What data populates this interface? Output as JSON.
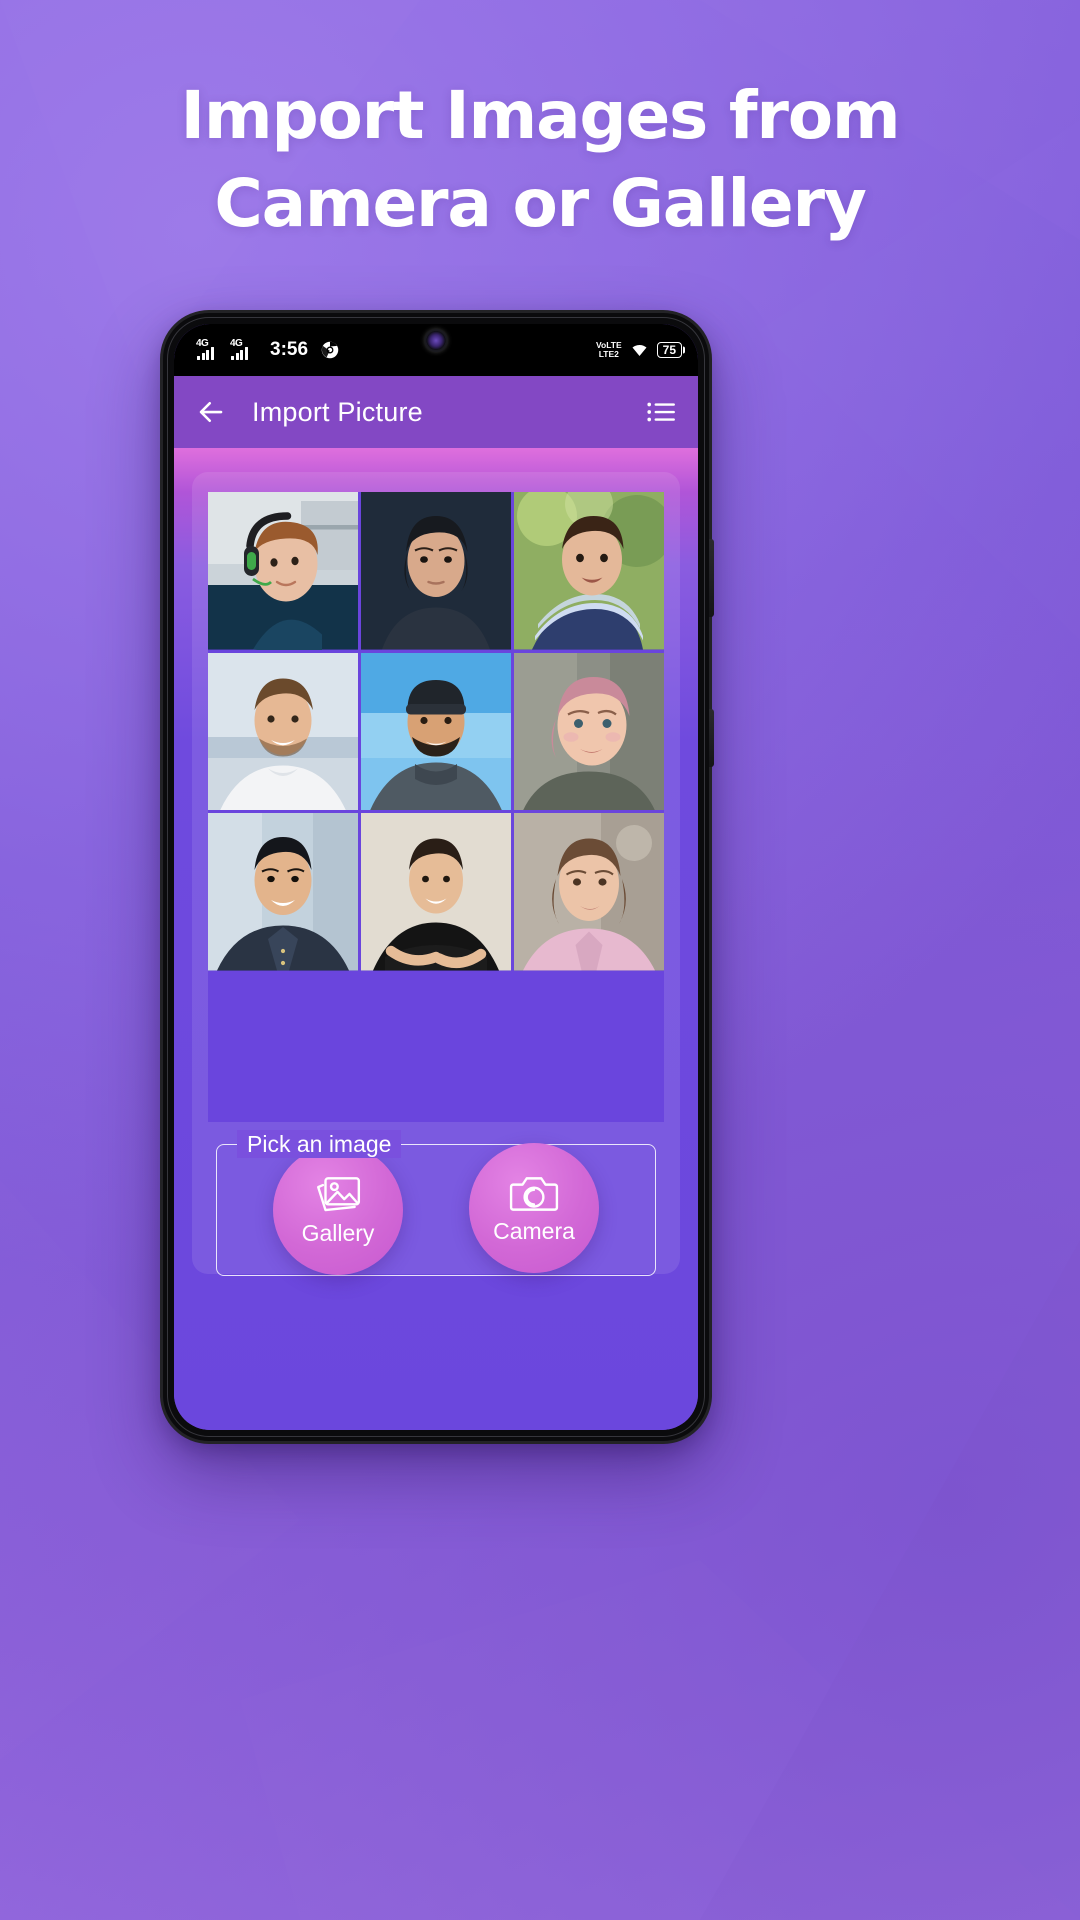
{
  "promo": {
    "headline_line1": "Import Images from",
    "headline_line2": "Camera or Gallery",
    "bg_color": "#8461dd"
  },
  "phone": {
    "statusbar": {
      "network_1": "4G",
      "network_2": "4G",
      "clock": "3:56",
      "chrome_icon": "chrome-icon",
      "volte_line1": "VoLTE",
      "volte_line2": "LTE2",
      "wifi_icon": "wifi-icon",
      "battery_level": "75"
    },
    "appbar": {
      "back_icon": "back-arrow-icon",
      "title": "Import Picture",
      "menu_icon": "list-menu-icon",
      "bar_color": "#8348c4"
    },
    "gallery": {
      "grid_columns": 3,
      "grid_rows": 3,
      "photos": [
        {
          "id": "photo-1",
          "alt": "Boy with green headphones",
          "bg": "#cbd3d9",
          "skin": "#e8bfa4",
          "hair": "#9a5a2e",
          "shirt": "#12304a",
          "accent": "#3fa94a"
        },
        {
          "id": "photo-2",
          "alt": "Woman with dark hair, dark background",
          "bg": "#1d2733",
          "skin": "#d8a98b",
          "hair": "#171a1f",
          "shirt": "#2a3340",
          "accent": "#4a5a6b"
        },
        {
          "id": "photo-3",
          "alt": "Boy in striped sweater outdoors",
          "bg": "#9fbf72",
          "skin": "#e4b899",
          "hair": "#3a2416",
          "shirt": "#2e3e6e",
          "accent": "#cfe0ff"
        },
        {
          "id": "photo-4",
          "alt": "Smiling man in white t-shirt at beach",
          "bg": "#cfd9e2",
          "skin": "#e6b894",
          "hair": "#6b4a2c",
          "shirt": "#f3f4f6",
          "accent": "#a9bfd4"
        },
        {
          "id": "photo-5",
          "alt": "Man with beanie, blue sky",
          "bg": "#7ec4ef",
          "skin": "#d8a174",
          "hair": "#20252b",
          "shirt": "#4f5a63",
          "accent": "#2b3a46"
        },
        {
          "id": "photo-6",
          "alt": "Young woman with pink hair",
          "bg": "#8c8f86",
          "skin": "#f0c6ad",
          "hair": "#c98a9a",
          "shirt": "#5d6459",
          "accent": "#e7a9b6"
        },
        {
          "id": "photo-7",
          "alt": "Man in navy shirt, light background",
          "bg": "#c3d2dd",
          "skin": "#e3b48c",
          "hair": "#14161b",
          "shirt": "#2a3444",
          "accent": "#8fa3b5"
        },
        {
          "id": "photo-8",
          "alt": "Man in black t-shirt, arms crossed",
          "bg": "#ded8cd",
          "skin": "#e6bc97",
          "hair": "#2a1e16",
          "shirt": "#141414",
          "accent": "#bdb4a6"
        },
        {
          "id": "photo-9",
          "alt": "Woman in pink jacket",
          "bg": "#b9b1a6",
          "skin": "#ecc4a8",
          "hair": "#6b4c36",
          "shirt": "#e7b9cf",
          "accent": "#cfa98e"
        }
      ]
    },
    "picker": {
      "legend": "Pick an image",
      "buttons": [
        {
          "id": "gallery-button",
          "label": "Gallery",
          "icon": "gallery-image-icon"
        },
        {
          "id": "camera-button",
          "label": "Camera",
          "icon": "camera-icon"
        }
      ],
      "button_color": "#d268d6"
    }
  }
}
